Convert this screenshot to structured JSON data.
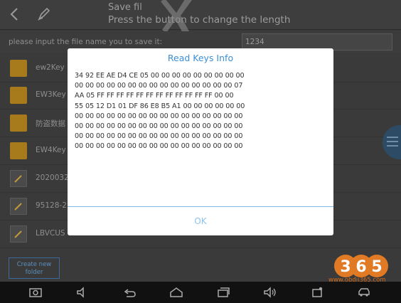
{
  "appbar": {
    "title_line1": "Save fil",
    "title_line2": "Press the     button to change the length"
  },
  "input_row": {
    "label": "please input the file name you to save it:",
    "value": "1234"
  },
  "files": [
    {
      "name": "ew2Key",
      "icon": "folder-icon"
    },
    {
      "name": "EW3Key",
      "icon": "folder-icon"
    },
    {
      "name": "防盗数据",
      "icon": "folder-icon"
    },
    {
      "name": "EW4Key",
      "icon": "folder-icon"
    },
    {
      "name": "2020032",
      "icon": "document-icon"
    },
    {
      "name": "95128-2",
      "icon": "document-icon"
    },
    {
      "name": "LBVCUS",
      "icon": "document-icon"
    }
  ],
  "create_folder": {
    "line1": "Create new",
    "line2": "folder"
  },
  "dialog": {
    "title": "Read Keys Info",
    "lines": [
      "34 92 EE AE D4 CE 05 00 00 00 00 00 00 00 00 00",
      "00 00 00 00 00 00 00 00 00 00 00 00 00 00 00 07",
      "AA 05 FF FF FF FF FF FF FF FF FF FF FF FF 00 00",
      "55 05 12 D1 01 DF 86 E8 B5 A1 00 00 00 00 00 00",
      "00 00 00 00 00 00 00 00 00 00 00 00 00 00 00 00",
      "00 00 00 00 00 00 00 00 00 00 00 00 00 00 00 00",
      "00 00 00 00 00 00 00 00 00 00 00 00 00 00 00 00",
      "00 00 00 00 00 00 00 00 00 00 00 00 00 00 00 00"
    ],
    "ok_label": "OK"
  },
  "watermark": {
    "url": "www.obdii365.com"
  },
  "colors": {
    "accent": "#3a8fd6",
    "folder": "#a77a1c",
    "watermark": "#d26a1c"
  }
}
